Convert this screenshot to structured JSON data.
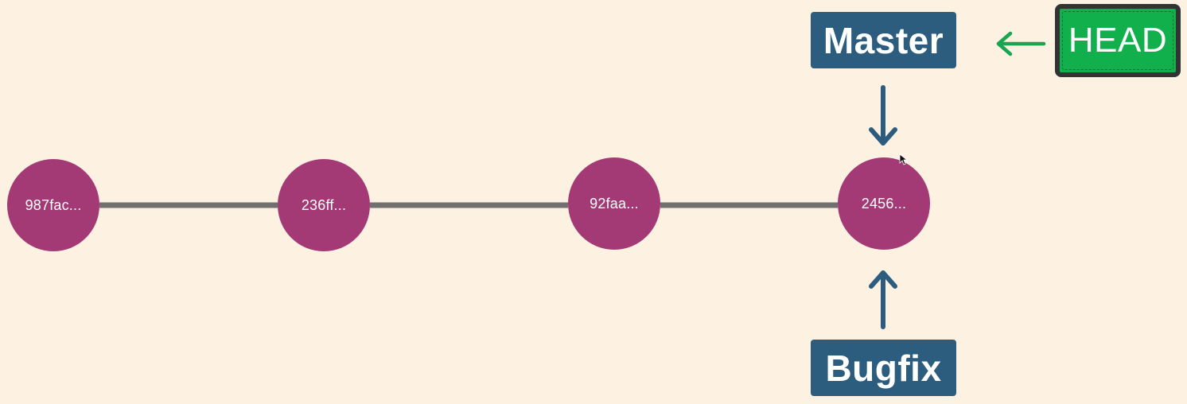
{
  "commits": [
    {
      "hash": "987fac..."
    },
    {
      "hash": "236ff..."
    },
    {
      "hash": "92faa..."
    },
    {
      "hash": "2456..."
    }
  ],
  "branches": {
    "master": {
      "label": "Master"
    },
    "bugfix": {
      "label": "Bugfix"
    }
  },
  "head": {
    "label": "HEAD"
  },
  "colors": {
    "background": "#fdf1e1",
    "commit": "#a33a76",
    "branch": "#2c5c7e",
    "head_fill": "#12b04c",
    "head_border": "#333333",
    "head_arrow": "#1aa551",
    "link": "#707070"
  }
}
